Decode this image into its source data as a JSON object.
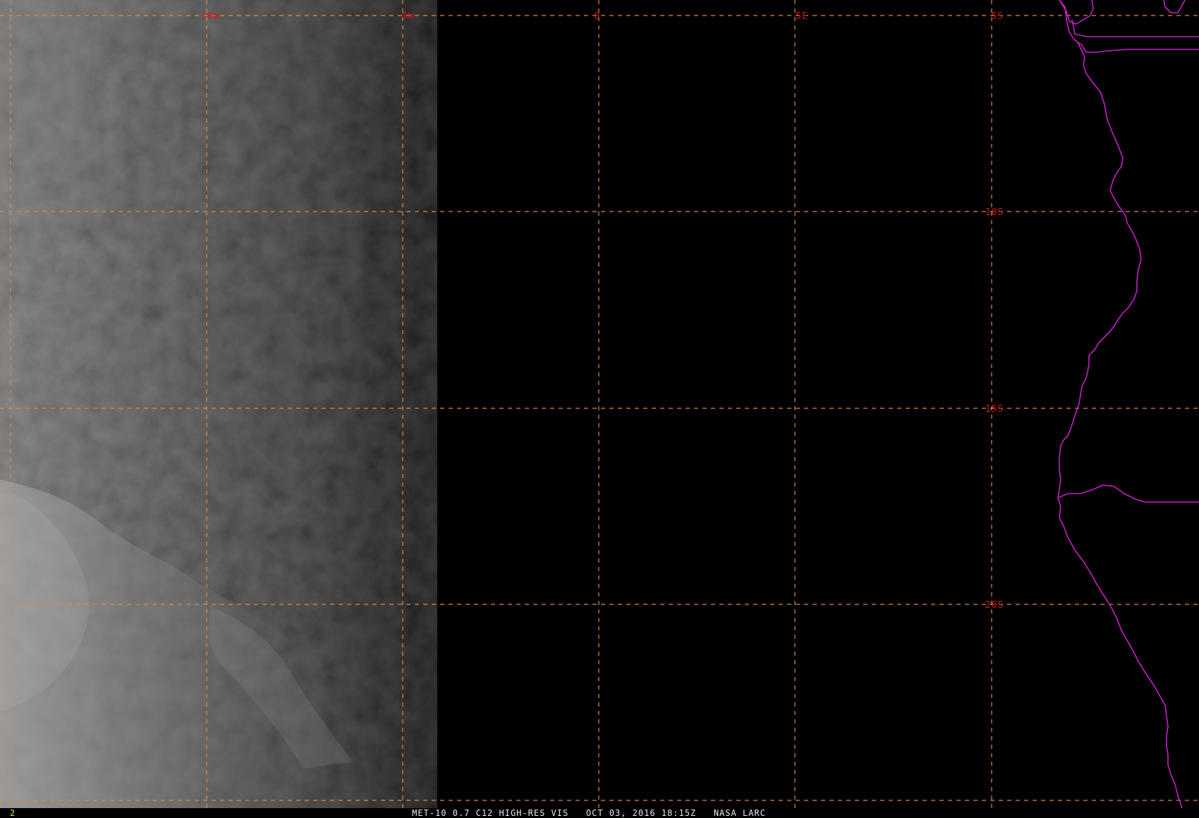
{
  "viewer": {
    "frame_number": "2",
    "caption": "MET-10 0.7 C12 HIGH-RES VIS   OCT 03, 2016 18:15Z   NASA LARC"
  },
  "colors": {
    "background": "#000000",
    "gridline": "#d98a4a",
    "grid_label": "#d01818",
    "borders": "#c81ec8",
    "frame_number": "#e6d84a",
    "caption": "#e6e6e6"
  },
  "grid": {
    "longitude_labels": [
      "10W",
      "5W",
      "0",
      "5E",
      "5S"
    ],
    "latitude_labels": [
      "10S",
      "15S",
      "20S"
    ]
  },
  "imagery": {
    "channel": "visible",
    "illuminated_side": "west",
    "terminator": "dusk, near 5W"
  }
}
